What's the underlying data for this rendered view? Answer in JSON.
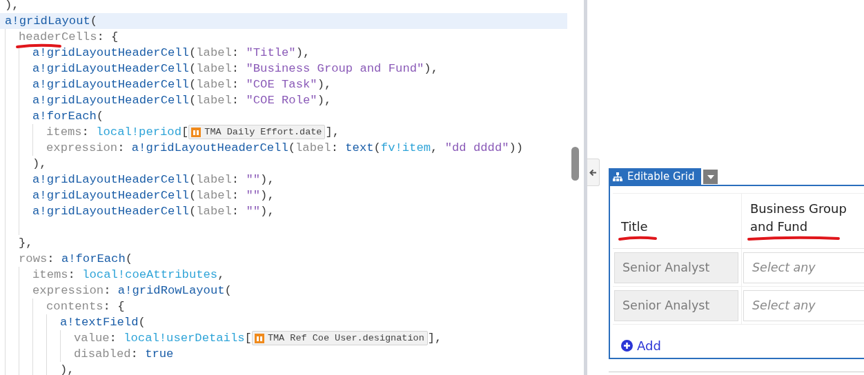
{
  "editor": {
    "lines": [
      {
        "highlighted": false,
        "tokens": [
          {
            "kind": "punc",
            "text": "),"
          }
        ]
      },
      {
        "highlighted": true,
        "tokens": [
          {
            "kind": "fn",
            "text": "a!gridLayout"
          },
          {
            "kind": "punc",
            "text": "("
          }
        ],
        "children": [
          {
            "highlighted": false,
            "tokens": [
              {
                "kind": "param",
                "text": "headerCells",
                "marked": true
              },
              {
                "kind": "punc",
                "text": ": {"
              }
            ],
            "children": [
              {
                "highlighted": false,
                "tokens": [
                  {
                    "kind": "fn",
                    "text": "a!gridLayoutHeaderCell"
                  },
                  {
                    "kind": "punc",
                    "text": "("
                  },
                  {
                    "kind": "param",
                    "text": "label"
                  },
                  {
                    "kind": "punc",
                    "text": ": "
                  },
                  {
                    "kind": "str",
                    "text": "\"Title\""
                  },
                  {
                    "kind": "punc",
                    "text": "),"
                  }
                ]
              },
              {
                "highlighted": false,
                "tokens": [
                  {
                    "kind": "fn",
                    "text": "a!gridLayoutHeaderCell"
                  },
                  {
                    "kind": "punc",
                    "text": "("
                  },
                  {
                    "kind": "param",
                    "text": "label"
                  },
                  {
                    "kind": "punc",
                    "text": ": "
                  },
                  {
                    "kind": "str",
                    "text": "\"Business Group and Fund\""
                  },
                  {
                    "kind": "punc",
                    "text": "),"
                  }
                ]
              },
              {
                "highlighted": false,
                "tokens": [
                  {
                    "kind": "fn",
                    "text": "a!gridLayoutHeaderCell"
                  },
                  {
                    "kind": "punc",
                    "text": "("
                  },
                  {
                    "kind": "param",
                    "text": "label"
                  },
                  {
                    "kind": "punc",
                    "text": ": "
                  },
                  {
                    "kind": "str",
                    "text": "\"COE Task\""
                  },
                  {
                    "kind": "punc",
                    "text": "),"
                  }
                ]
              },
              {
                "highlighted": false,
                "tokens": [
                  {
                    "kind": "fn",
                    "text": "a!gridLayoutHeaderCell"
                  },
                  {
                    "kind": "punc",
                    "text": "("
                  },
                  {
                    "kind": "param",
                    "text": "label"
                  },
                  {
                    "kind": "punc",
                    "text": ": "
                  },
                  {
                    "kind": "str",
                    "text": "\"COE Role\""
                  },
                  {
                    "kind": "punc",
                    "text": "),"
                  }
                ]
              },
              {
                "highlighted": false,
                "tokens": [
                  {
                    "kind": "fn",
                    "text": "a!forEach"
                  },
                  {
                    "kind": "punc",
                    "text": "("
                  }
                ],
                "children": [
                  {
                    "highlighted": false,
                    "tokens": [
                      {
                        "kind": "param",
                        "text": "items"
                      },
                      {
                        "kind": "punc",
                        "text": ": "
                      },
                      {
                        "kind": "var",
                        "text": "local!period"
                      },
                      {
                        "kind": "punc",
                        "text": "["
                      },
                      {
                        "kind": "chip",
                        "text": "TMA Daily Effort.date"
                      },
                      {
                        "kind": "punc",
                        "text": "],"
                      }
                    ]
                  },
                  {
                    "highlighted": false,
                    "tokens": [
                      {
                        "kind": "param",
                        "text": "expression"
                      },
                      {
                        "kind": "punc",
                        "text": ": "
                      },
                      {
                        "kind": "fn",
                        "text": "a!gridLayoutHeaderCell"
                      },
                      {
                        "kind": "punc",
                        "text": "("
                      },
                      {
                        "kind": "param",
                        "text": "label"
                      },
                      {
                        "kind": "punc",
                        "text": ": "
                      },
                      {
                        "kind": "fn",
                        "text": "text"
                      },
                      {
                        "kind": "punc",
                        "text": "("
                      },
                      {
                        "kind": "var",
                        "text": "fv!item"
                      },
                      {
                        "kind": "punc",
                        "text": ", "
                      },
                      {
                        "kind": "str",
                        "text": "\"dd dddd\""
                      },
                      {
                        "kind": "punc",
                        "text": "))"
                      }
                    ]
                  }
                ]
              },
              {
                "highlighted": false,
                "tokens": [
                  {
                    "kind": "punc",
                    "text": "),"
                  }
                ]
              },
              {
                "highlighted": false,
                "tokens": [
                  {
                    "kind": "fn",
                    "text": "a!gridLayoutHeaderCell"
                  },
                  {
                    "kind": "punc",
                    "text": "("
                  },
                  {
                    "kind": "param",
                    "text": "label"
                  },
                  {
                    "kind": "punc",
                    "text": ": "
                  },
                  {
                    "kind": "str",
                    "text": "\"\""
                  },
                  {
                    "kind": "punc",
                    "text": "),"
                  }
                ]
              },
              {
                "highlighted": false,
                "tokens": [
                  {
                    "kind": "fn",
                    "text": "a!gridLayoutHeaderCell"
                  },
                  {
                    "kind": "punc",
                    "text": "("
                  },
                  {
                    "kind": "param",
                    "text": "label"
                  },
                  {
                    "kind": "punc",
                    "text": ": "
                  },
                  {
                    "kind": "str",
                    "text": "\"\""
                  },
                  {
                    "kind": "punc",
                    "text": "),"
                  }
                ]
              },
              {
                "highlighted": false,
                "tokens": [
                  {
                    "kind": "fn",
                    "text": "a!gridLayoutHeaderCell"
                  },
                  {
                    "kind": "punc",
                    "text": "("
                  },
                  {
                    "kind": "param",
                    "text": "label"
                  },
                  {
                    "kind": "punc",
                    "text": ": "
                  },
                  {
                    "kind": "str",
                    "text": "\"\""
                  },
                  {
                    "kind": "punc",
                    "text": "),"
                  }
                ]
              },
              {
                "highlighted": false
              }
            ]
          },
          {
            "highlighted": false,
            "tokens": [
              {
                "kind": "punc",
                "text": "},"
              }
            ]
          },
          {
            "highlighted": false,
            "tokens": [
              {
                "kind": "param",
                "text": "rows"
              },
              {
                "kind": "punc",
                "text": ": "
              },
              {
                "kind": "fn",
                "text": "a!forEach"
              },
              {
                "kind": "punc",
                "text": "("
              }
            ],
            "children": [
              {
                "highlighted": false,
                "tokens": [
                  {
                    "kind": "param",
                    "text": "items"
                  },
                  {
                    "kind": "punc",
                    "text": ": "
                  },
                  {
                    "kind": "var",
                    "text": "local!coeAttributes"
                  },
                  {
                    "kind": "punc",
                    "text": ","
                  }
                ]
              },
              {
                "highlighted": false,
                "tokens": [
                  {
                    "kind": "param",
                    "text": "expression"
                  },
                  {
                    "kind": "punc",
                    "text": ": "
                  },
                  {
                    "kind": "fn",
                    "text": "a!gridRowLayout"
                  },
                  {
                    "kind": "punc",
                    "text": "("
                  }
                ],
                "children": [
                  {
                    "highlighted": false,
                    "tokens": [
                      {
                        "kind": "param",
                        "text": "contents"
                      },
                      {
                        "kind": "punc",
                        "text": ": {"
                      }
                    ],
                    "children": [
                      {
                        "highlighted": false,
                        "tokens": [
                          {
                            "kind": "fn",
                            "text": "a!textField"
                          },
                          {
                            "kind": "punc",
                            "text": "("
                          }
                        ],
                        "children": [
                          {
                            "highlighted": false,
                            "tokens": [
                              {
                                "kind": "param",
                                "text": "value"
                              },
                              {
                                "kind": "punc",
                                "text": ": "
                              },
                              {
                                "kind": "var",
                                "text": "local!userDetails"
                              },
                              {
                                "kind": "punc",
                                "text": "["
                              },
                              {
                                "kind": "chip",
                                "text": "TMA Ref Coe User.designation"
                              },
                              {
                                "kind": "punc",
                                "text": "],"
                              }
                            ]
                          },
                          {
                            "highlighted": false,
                            "tokens": [
                              {
                                "kind": "param",
                                "text": "disabled"
                              },
                              {
                                "kind": "punc",
                                "text": ": "
                              },
                              {
                                "kind": "kw",
                                "text": "true"
                              }
                            ]
                          }
                        ]
                      },
                      {
                        "highlighted": false,
                        "tokens": [
                          {
                            "kind": "punc",
                            "text": "),"
                          }
                        ]
                      }
                    ]
                  }
                ]
              }
            ]
          }
        ]
      }
    ]
  },
  "grid": {
    "tab_label": "Editable Grid",
    "columns": [
      {
        "label": "Title",
        "marked": true
      },
      {
        "label": "Business Group and Fund",
        "marked": true
      }
    ],
    "rows": [
      {
        "title": "Senior Analyst",
        "placeholder": "Select any"
      },
      {
        "title": "Senior Analyst",
        "placeholder": "Select any"
      }
    ],
    "add_label": "Add"
  }
}
